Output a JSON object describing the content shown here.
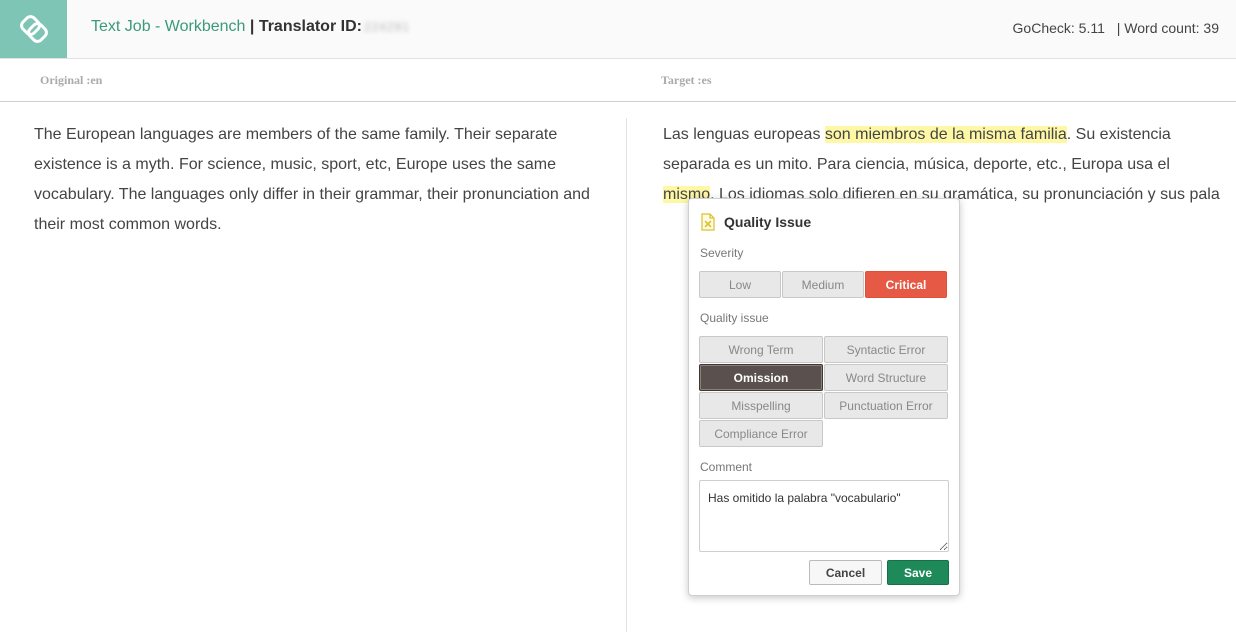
{
  "header": {
    "job_title": "Text Job - Workbench",
    "separator": " | ",
    "translator_label": "Translator ID:",
    "translator_id": "224291",
    "gocheck": "GoCheck: 5.11",
    "word_count": "| Word count: 39",
    "logo_icon": "app-logo-icon",
    "colors": {
      "logo_bg": "#7ec5b6",
      "job_title": "#3a9a7a"
    }
  },
  "languages": {
    "original_label": "Original :en",
    "target_label": "Target :es"
  },
  "source": {
    "text": "The European languages are members of the same family. Their separate existence is a myth. For science, music, sport, etc, Europe uses the same vocabulary. The languages only differ in their grammar, their pronunciation and their most common words."
  },
  "target": {
    "part1": "Las lenguas europeas ",
    "highlight1": "son miembros de la misma familia",
    "part2": ". Su existencia separada es un mito. Para ciencia, música, deporte, etc., Europa usa el ",
    "highlight2": "mismo",
    "part3": ". Los idiomas solo difieren en su gramática, su pronunciación y sus pala",
    "highlight_color": "#fdf7a6"
  },
  "quality_popup": {
    "title": "Quality Issue",
    "title_icon": "document-x-icon",
    "severity_label": "Severity",
    "severity_options": [
      "Low",
      "Medium",
      "Critical"
    ],
    "severity_selected": "Critical",
    "issue_label": "Quality issue",
    "issue_options": [
      "Wrong Term",
      "Syntactic Error",
      "Omission",
      "Word Structure",
      "Misspelling",
      "Punctuation Error",
      "Compliance Error"
    ],
    "issue_selected": "Omission",
    "comment_label": "Comment",
    "comment_value": "Has omitido la palabra \"vocabulario\"",
    "cancel_label": "Cancel",
    "save_label": "Save",
    "colors": {
      "critical": "#e65a45",
      "selected_issue": "#5a514e",
      "save": "#1e8a5a"
    }
  }
}
